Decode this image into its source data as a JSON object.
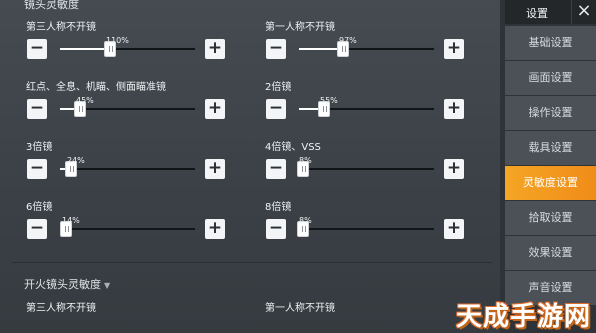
{
  "sections": {
    "scope_sensitivity": "镜头灵敏度",
    "firing_scope_sensitivity": "开火镜头灵敏度"
  },
  "settings": [
    {
      "label": "第三人称不开镜",
      "value": 110,
      "value_text": "110%"
    },
    {
      "label": "第一人称不开镜",
      "value": 97,
      "value_text": "97%"
    },
    {
      "label": "红点、全息、机瞄、侧面瞄准镜",
      "value": 45,
      "value_text": "45%"
    },
    {
      "label": "2倍镜",
      "value": 55,
      "value_text": "55%"
    },
    {
      "label": "3倍镜",
      "value": 24,
      "value_text": "24%"
    },
    {
      "label": "4倍镜、VSS",
      "value": 8,
      "value_text": "8%"
    },
    {
      "label": "6倍镜",
      "value": 14,
      "value_text": "14%"
    },
    {
      "label": "8倍镜",
      "value": 8,
      "value_text": "8%"
    }
  ],
  "slider_max": 300,
  "firing_settings": [
    {
      "label": "第三人称不开镜"
    },
    {
      "label": "第一人称不开镜"
    }
  ],
  "header": {
    "title": "设置",
    "close_icon": "×"
  },
  "tabs": [
    {
      "label": "基础设置",
      "active": false
    },
    {
      "label": "画面设置",
      "active": false
    },
    {
      "label": "操作设置",
      "active": false
    },
    {
      "label": "载具设置",
      "active": false
    },
    {
      "label": "灵敏度设置",
      "active": true
    },
    {
      "label": "拾取设置",
      "active": false
    },
    {
      "label": "效果设置",
      "active": false
    },
    {
      "label": "声音设置",
      "active": false
    }
  ],
  "watermark": "天成手游网",
  "colors": {
    "accent": "#f5a524",
    "panel": "#40464b",
    "tab": "#4b5156"
  }
}
